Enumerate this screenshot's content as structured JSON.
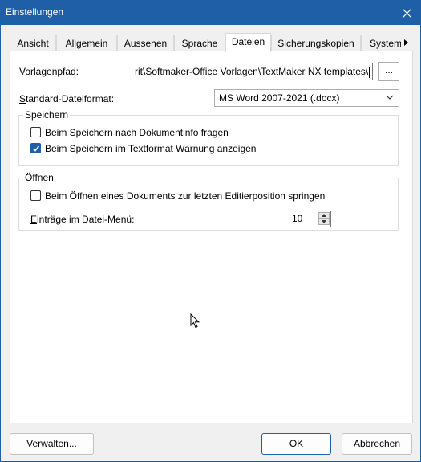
{
  "window": {
    "title": "Einstellungen"
  },
  "tabs": [
    {
      "label": "Ansicht"
    },
    {
      "label": "Allgemein"
    },
    {
      "label": "Aussehen"
    },
    {
      "label": "Sprache"
    },
    {
      "label": "Dateien",
      "active": true
    },
    {
      "label": "Sicherungskopien"
    },
    {
      "label": "System"
    }
  ],
  "vorlagen": {
    "label_pre": "V",
    "label_rest": "orlagenpfad:",
    "value": "rit\\Softmaker-Office Vorlagen\\TextMaker NX templates\\",
    "browse_label": "..."
  },
  "dateiformat": {
    "label_pre": "S",
    "label_rest": "tandard-Dateiformat:",
    "selected": "MS Word 2007-2021 (.docx)"
  },
  "speichern": {
    "legend": "Speichern",
    "opt1": {
      "pre": "Beim Speichern nach Do",
      "ul": "k",
      "post": "umentinfo fragen",
      "checked": false
    },
    "opt2": {
      "pre": "Beim Speichern im Textformat ",
      "ul": "W",
      "post": "arnung anzeigen",
      "checked": true
    }
  },
  "oeffnen": {
    "legend": "Öffnen",
    "opt1": {
      "pre": "Beim Öffnen eines Dokuments zur letzten Editierposition springen",
      "checked": false
    },
    "eintraege": {
      "pre": "",
      "ul": "E",
      "post": "inträge im Datei-Menü:",
      "value": "10"
    }
  },
  "footer": {
    "verwalten_ul": "V",
    "verwalten_rest": "erwalten...",
    "ok": "OK",
    "cancel": "Abbrechen"
  },
  "colors": {
    "accent": "#1f5fa8",
    "panel": "#ffffff",
    "window": "#f0f0f0"
  }
}
